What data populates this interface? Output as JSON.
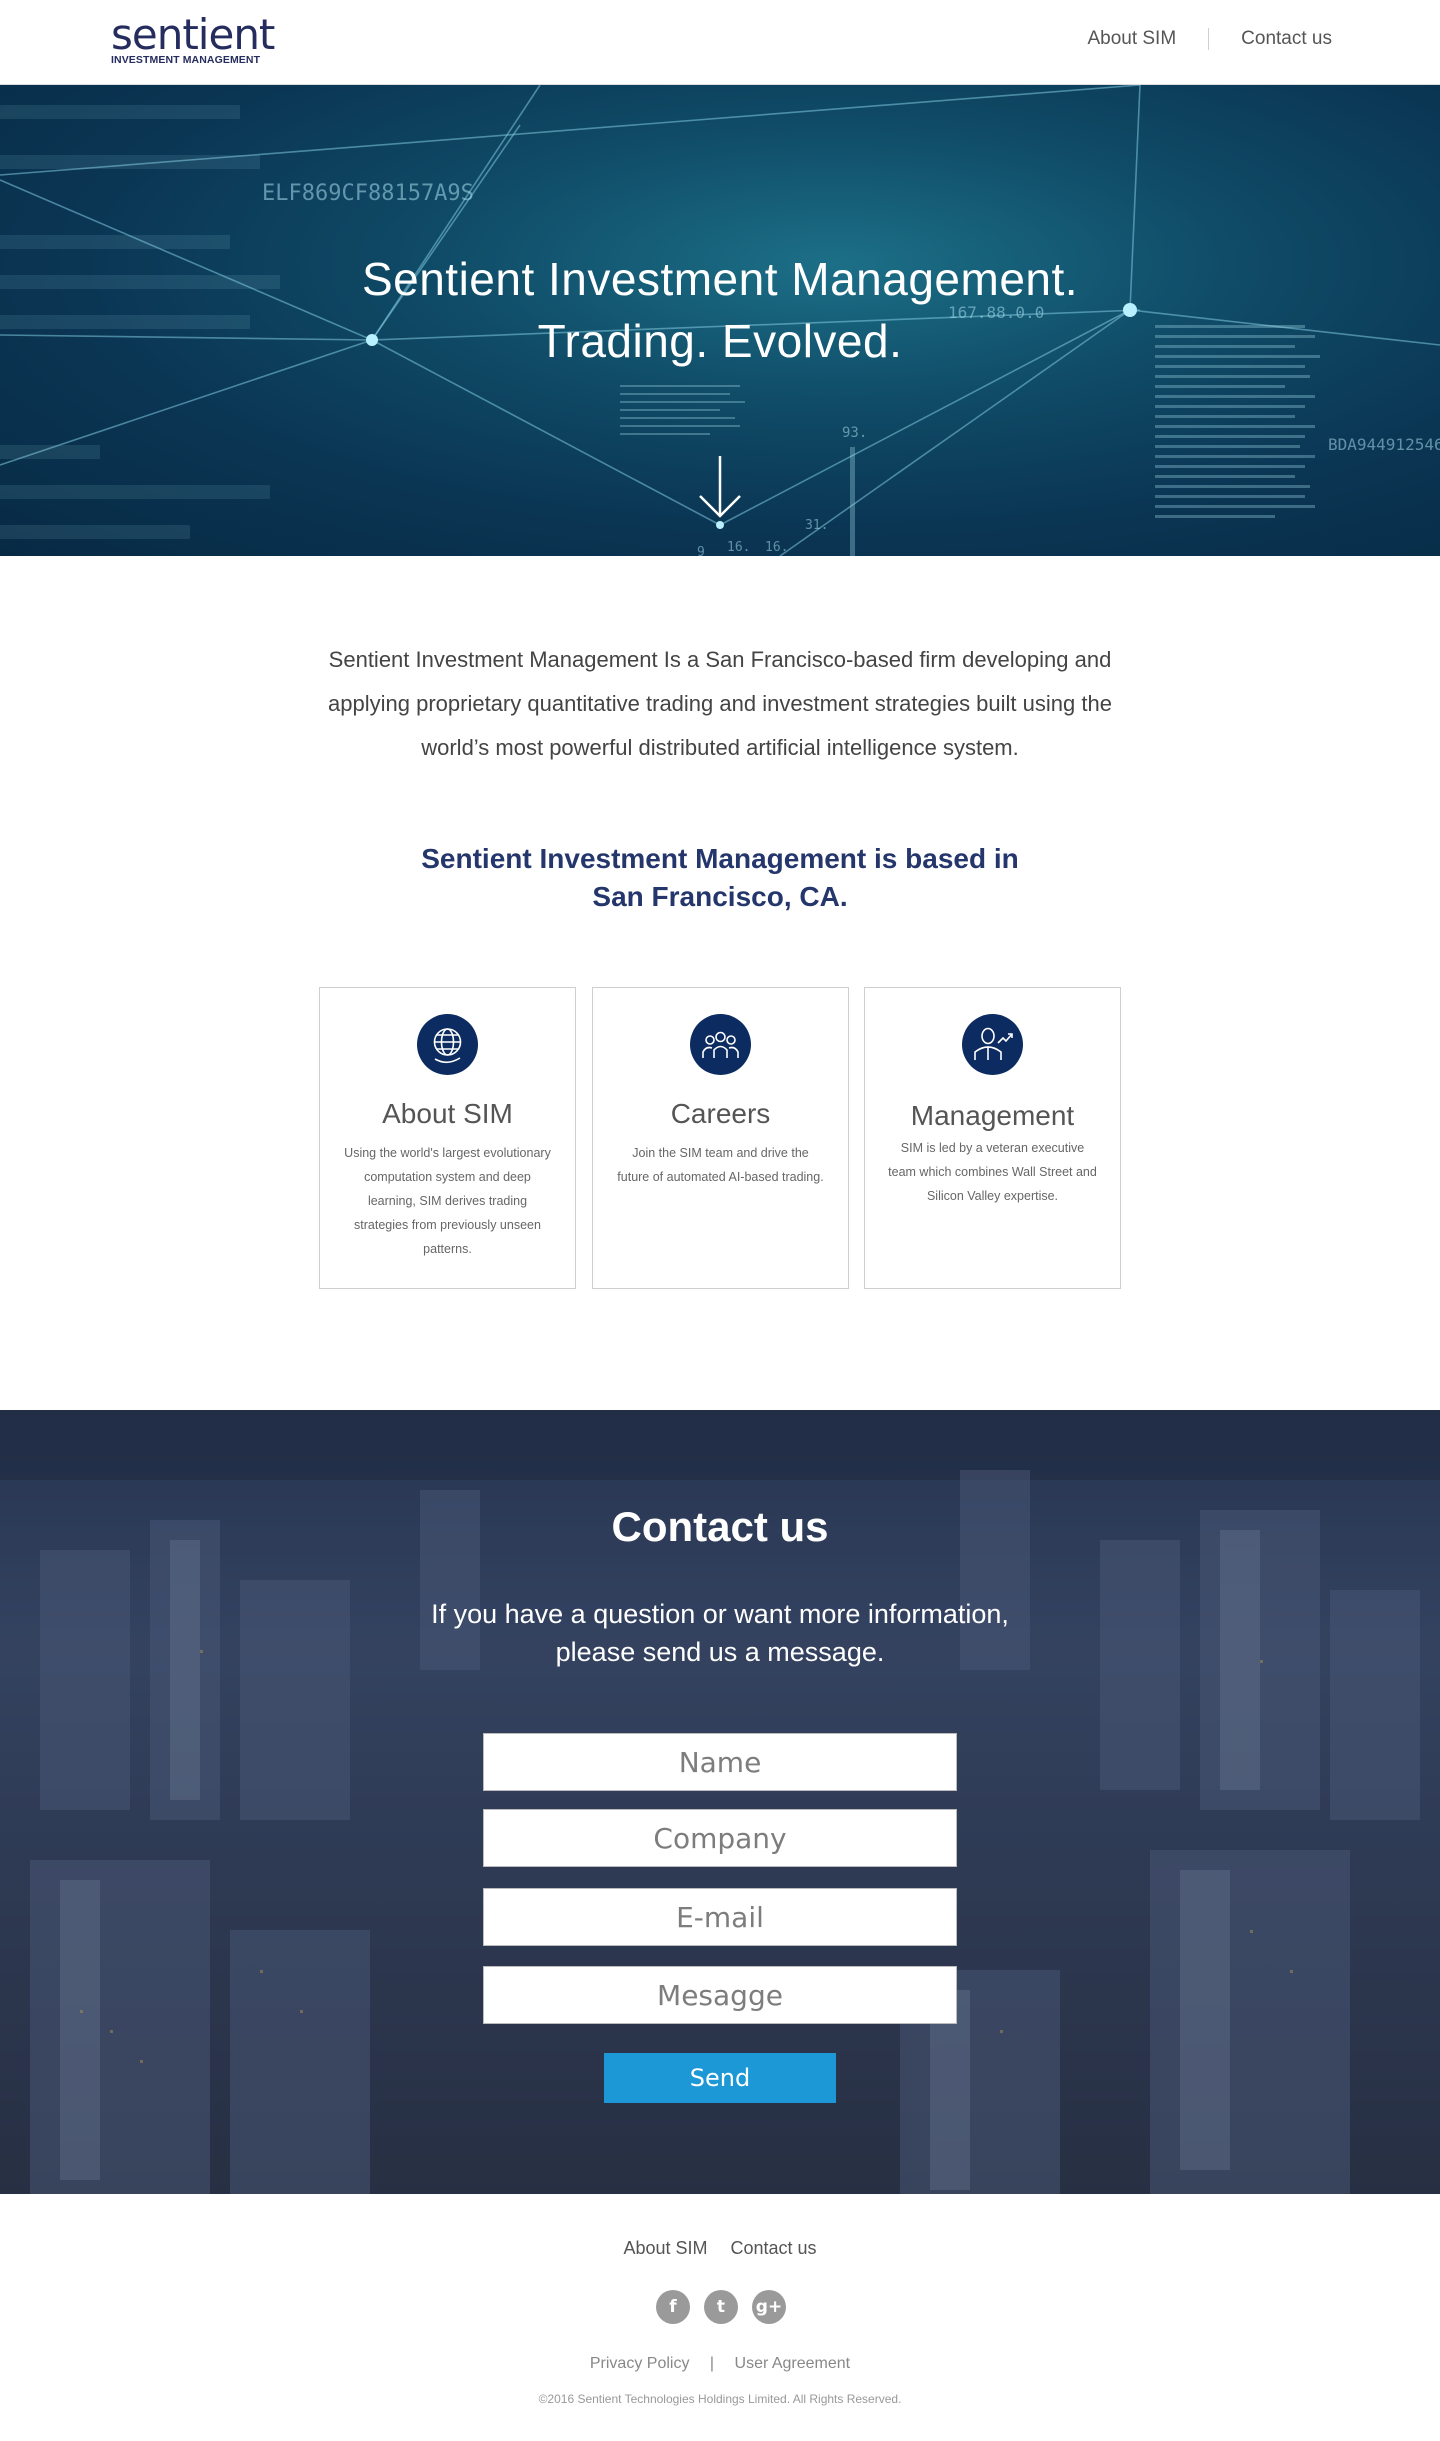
{
  "header": {
    "logo_word": "sentient",
    "logo_sub": "INVESTMENT MANAGEMENT",
    "nav": [
      "About SIM",
      "Contact us"
    ]
  },
  "hero": {
    "line1": "Sentient Investment Management.",
    "line2": "Trading. Evolved.",
    "decor_text": [
      "ELF869CF88157A9S",
      "167.88.0.0",
      "BDA944912546",
      "93.",
      "16.",
      "16.",
      "31.",
      "9"
    ]
  },
  "intro": "Sentient Investment Management Is a San Francisco-based firm developing and applying proprietary quantitative trading and investment strategies built using the world’s most powerful distributed artificial intelligence system.",
  "based": {
    "line1": "Sentient Investment Management is based in",
    "line2": "San Francisco, CA."
  },
  "cards": [
    {
      "icon": "globe-icon",
      "title": "About SIM",
      "text": "Using the world's largest evolutionary computation system and deep learning, SIM derives trading strategies from previously unseen patterns."
    },
    {
      "icon": "team-icon",
      "title": "Careers",
      "text": "Join the SIM team and drive the future of automated AI-based trading."
    },
    {
      "icon": "executive-icon",
      "title": "Management",
      "text": "SIM is led by a veteran executive team which combines Wall Street and Silicon Valley expertise."
    }
  ],
  "contact": {
    "title": "Contact us",
    "subtitle": "If you have a question or want more information, please send us a message.",
    "fields": {
      "name": "Name",
      "company": "Company",
      "email": "E-mail",
      "message": "Mesagge"
    },
    "send": "Send"
  },
  "footer": {
    "nav": [
      "About SIM",
      "Contact us"
    ],
    "social": [
      "f",
      "t",
      "g+"
    ],
    "legal": [
      "Privacy Policy",
      "User Agreement"
    ],
    "legal_sep": "|",
    "copyright": "©2016 Sentient Technologies Holdings Limited. All Rights Reserved."
  },
  "colors": {
    "brand": "#252c5e",
    "heading_blue": "#24366b",
    "icon_navy": "#0c2b60",
    "button": "#1d98d6"
  }
}
